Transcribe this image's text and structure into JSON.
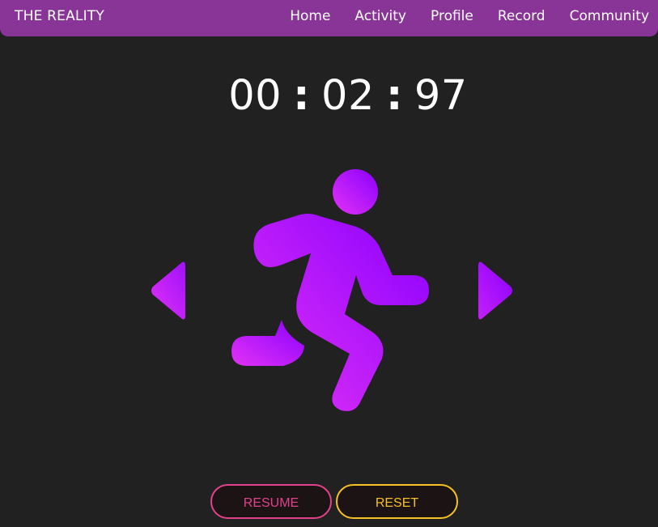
{
  "nav": {
    "brand": "THE REALITY",
    "links": [
      "Home",
      "Activity",
      "Profile",
      "Record",
      "Community"
    ]
  },
  "timer": {
    "minutes": "00",
    "seconds": "02",
    "hundredths": "97",
    "separator": ":"
  },
  "activity": {
    "icon": "running-person-icon",
    "gradient": [
      "#e232f5",
      "#8a00ff"
    ]
  },
  "controls": {
    "resume_label": "RESUME",
    "reset_label": "RESET"
  },
  "colors": {
    "navbar": "#883597",
    "background": "#212121",
    "resume": "#e2418c",
    "reset": "#f5c124"
  }
}
